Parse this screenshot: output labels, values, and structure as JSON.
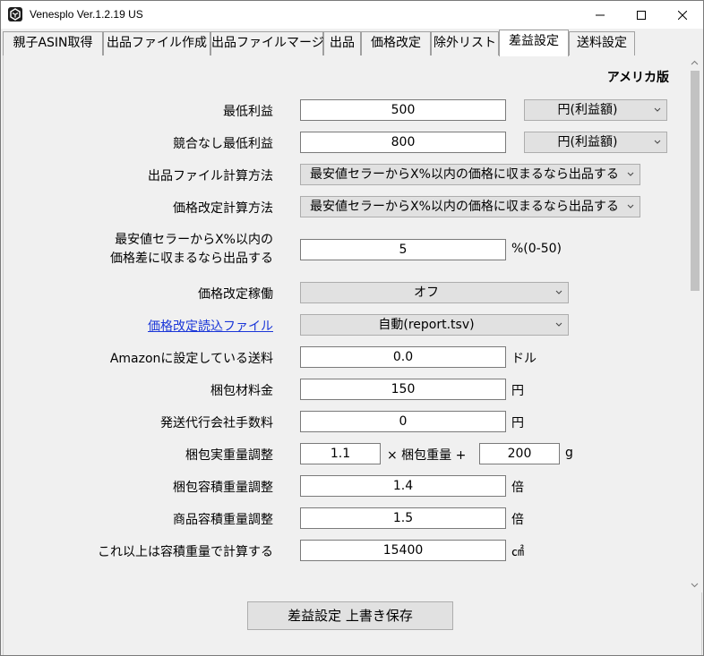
{
  "window": {
    "title": "Venesplo Ver.1.2.19 US"
  },
  "tabs": [
    {
      "label": "親子ASIN取得"
    },
    {
      "label": "出品ファイル作成"
    },
    {
      "label": "出品ファイルマージ"
    },
    {
      "label": "出品"
    },
    {
      "label": "価格改定"
    },
    {
      "label": "除外リスト"
    },
    {
      "label": "差益設定"
    },
    {
      "label": "送料設定"
    }
  ],
  "active_tab": "差益設定",
  "region": "アメリカ版",
  "form": {
    "min_profit": {
      "label": "最低利益",
      "value": "500",
      "unit_select": "円(利益額)"
    },
    "min_profit_no_comp": {
      "label": "競合なし最低利益",
      "value": "800",
      "unit_select": "円(利益額)"
    },
    "listing_calc": {
      "label": "出品ファイル計算方法",
      "selected": "最安値セラーからX%以内の価格に収まるなら出品する"
    },
    "price_calc": {
      "label": "価格改定計算方法",
      "selected": "最安値セラーからX%以内の価格に収まるなら出品する"
    },
    "within_pct": {
      "label_line1": "最安値セラーからX%以内の",
      "label_line2": "価格差に収まるなら出品する",
      "value": "5",
      "unit": "%(0-50)"
    },
    "price_revision_active": {
      "label": "価格改定稼働",
      "selected": "オフ"
    },
    "price_revision_file": {
      "label": "価格改定読込ファイル",
      "selected": "自動(report.tsv)"
    },
    "amazon_shipping": {
      "label": "Amazonに設定している送料",
      "value": "0.0",
      "unit": "ドル"
    },
    "packing_cost": {
      "label": "梱包材料金",
      "value": "150",
      "unit": "円"
    },
    "agent_fee": {
      "label": "発送代行会社手数料",
      "value": "0",
      "unit": "円"
    },
    "actual_weight_adj": {
      "label": "梱包実重量調整",
      "factor": "1.1",
      "mid_text": "× 梱包重量 +",
      "addend": "200",
      "unit": "g"
    },
    "volume_weight_adj": {
      "label": "梱包容積重量調整",
      "value": "1.4",
      "unit": "倍"
    },
    "product_volume_adj": {
      "label": "商品容積重量調整",
      "value": "1.5",
      "unit": "倍"
    },
    "volume_threshold": {
      "label": "これ以上は容積重量で計算する",
      "value": "15400",
      "unit": "㎠"
    }
  },
  "save_button": {
    "label": "差益設定 上書き保存"
  }
}
